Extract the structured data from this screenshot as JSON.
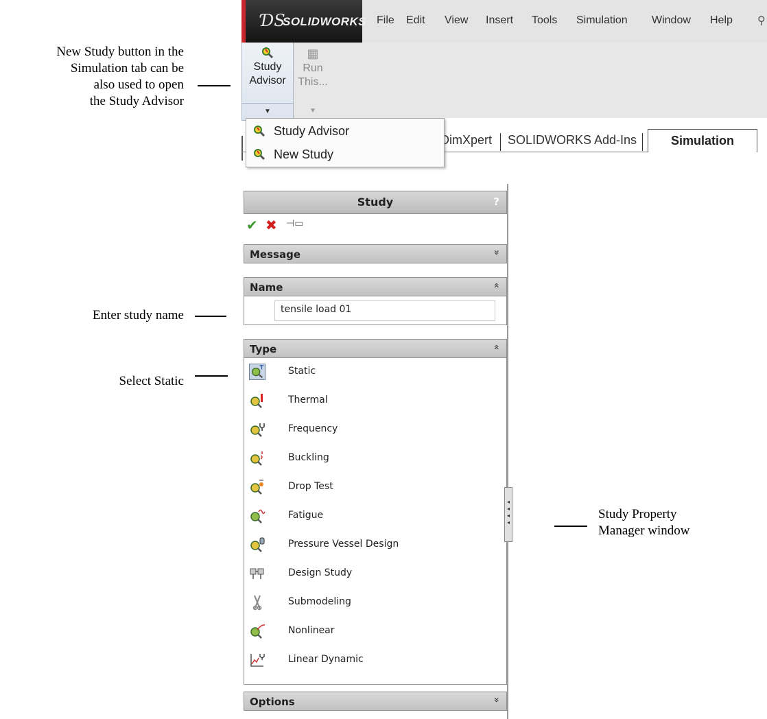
{
  "annotations": {
    "new_study": [
      "New Study button in the",
      "Simulation tab can be",
      "also used to open",
      "the Study Advisor"
    ],
    "enter_name": "Enter study name",
    "select_static": "Select Static",
    "property_manager": [
      "Study Property",
      "Manager window"
    ]
  },
  "menubar": {
    "logo_ds": "ƊS",
    "logo_text": "SOLIDWORKS",
    "items": [
      "File",
      "Edit",
      "View",
      "Insert",
      "Tools",
      "Simulation",
      "Window",
      "Help"
    ],
    "pin_icon": "pushpin-icon"
  },
  "ribbon": {
    "study_advisor": {
      "line1": "Study",
      "line2": "Advisor"
    },
    "run": {
      "line1": "Run",
      "line2": "This..."
    },
    "tabs": {
      "dimxpert": "DimXpert",
      "addins": "SOLIDWORKS Add-Ins",
      "simulation": "Simulation"
    }
  },
  "dropdown": {
    "items": [
      {
        "label": "Study Advisor",
        "icon": "magnifier-icon"
      },
      {
        "label": "New Study",
        "icon": "magnifier-icon"
      }
    ]
  },
  "property_manager": {
    "title": "Study",
    "help": "?",
    "message_group": {
      "label": "Message",
      "state": "collapsed"
    },
    "name_group": {
      "label": "Name",
      "value": "tensile load 01",
      "state": "expanded"
    },
    "type_group": {
      "label": "Type",
      "state": "expanded",
      "selected": "Static",
      "types": [
        {
          "label": "Static",
          "icon": "static-study-icon"
        },
        {
          "label": "Thermal",
          "icon": "thermal-study-icon"
        },
        {
          "label": "Frequency",
          "icon": "frequency-study-icon"
        },
        {
          "label": "Buckling",
          "icon": "buckling-study-icon"
        },
        {
          "label": "Drop Test",
          "icon": "drop-test-study-icon"
        },
        {
          "label": "Fatigue",
          "icon": "fatigue-study-icon"
        },
        {
          "label": "Pressure Vessel Design",
          "icon": "pressure-vessel-study-icon"
        },
        {
          "label": "Design Study",
          "icon": "design-study-icon"
        },
        {
          "label": "Submodeling",
          "icon": "submodeling-study-icon"
        },
        {
          "label": "Nonlinear",
          "icon": "nonlinear-study-icon"
        },
        {
          "label": "Linear Dynamic",
          "icon": "linear-dynamic-study-icon"
        }
      ]
    },
    "options_group": {
      "label": "Options",
      "state": "collapsed"
    }
  },
  "colors": {
    "ok": "#3c9a2e",
    "cancel": "#d21e1e",
    "logo_accent": "#c8262c"
  }
}
